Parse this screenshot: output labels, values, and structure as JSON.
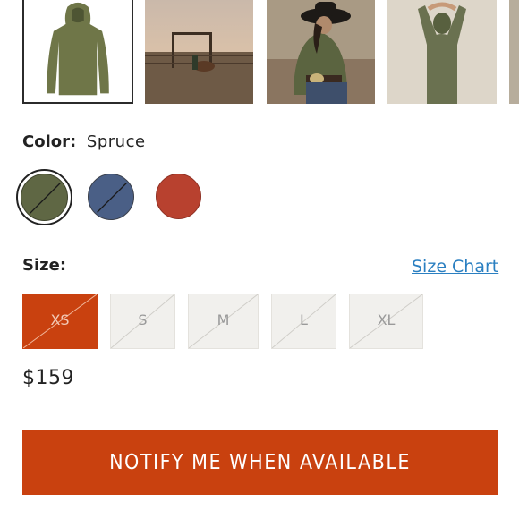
{
  "color": {
    "label": "Color:",
    "selected": "Spruce"
  },
  "swatches": [
    {
      "name": "Spruce",
      "hex": "#5f6744",
      "unavailable": true,
      "selected": true
    },
    {
      "name": "Blue",
      "hex": "#4a5f86",
      "unavailable": true,
      "selected": false
    },
    {
      "name": "Red",
      "hex": "#b8412f",
      "unavailable": false,
      "selected": false
    }
  ],
  "size": {
    "label": "Size:",
    "chart_link": "Size Chart",
    "options": [
      {
        "label": "XS",
        "selected": true,
        "unavailable": true
      },
      {
        "label": "S",
        "selected": false,
        "unavailable": true
      },
      {
        "label": "M",
        "selected": false,
        "unavailable": true
      },
      {
        "label": "L",
        "selected": false,
        "unavailable": true
      },
      {
        "label": "XL",
        "selected": false,
        "unavailable": true
      }
    ]
  },
  "price": "$159",
  "cta": {
    "label": "NOTIFY ME WHEN AVAILABLE"
  },
  "colors": {
    "accent": "#c9410f",
    "link": "#2a7fc1"
  }
}
